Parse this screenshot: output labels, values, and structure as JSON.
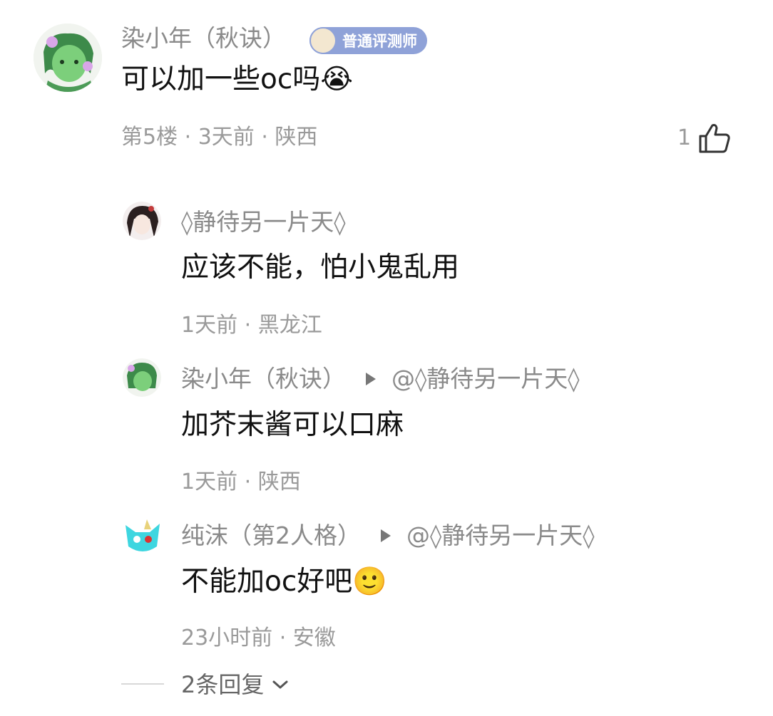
{
  "main_comment": {
    "username": "染小年（秋诀）",
    "badge_label": "普通评测师",
    "text": "可以加一些oc吗",
    "emoji": "😭",
    "meta": "第5楼 · 3天前 · 陕西",
    "like_count": "1",
    "like_icon": "thumbs-up-icon"
  },
  "replies": [
    {
      "username": "◊静待另一片天◊",
      "reply_to": "",
      "text": "应该不能，怕小鬼乱用",
      "meta": "1天前 · 黑龙江"
    },
    {
      "username": "染小年（秋诀）",
      "reply_to": "@◊静待另一片天◊",
      "text": "加芥末酱可以口麻",
      "meta": "1天前 · 陕西"
    },
    {
      "username": "纯沫（第2人格）",
      "reply_to": "@◊静待另一片天◊",
      "text": "不能加oc好吧",
      "emoji": "🙂",
      "meta": "23小时前 · 安徽"
    }
  ],
  "more_replies": {
    "label": "2条回复",
    "icon": "chevron-down-icon"
  }
}
